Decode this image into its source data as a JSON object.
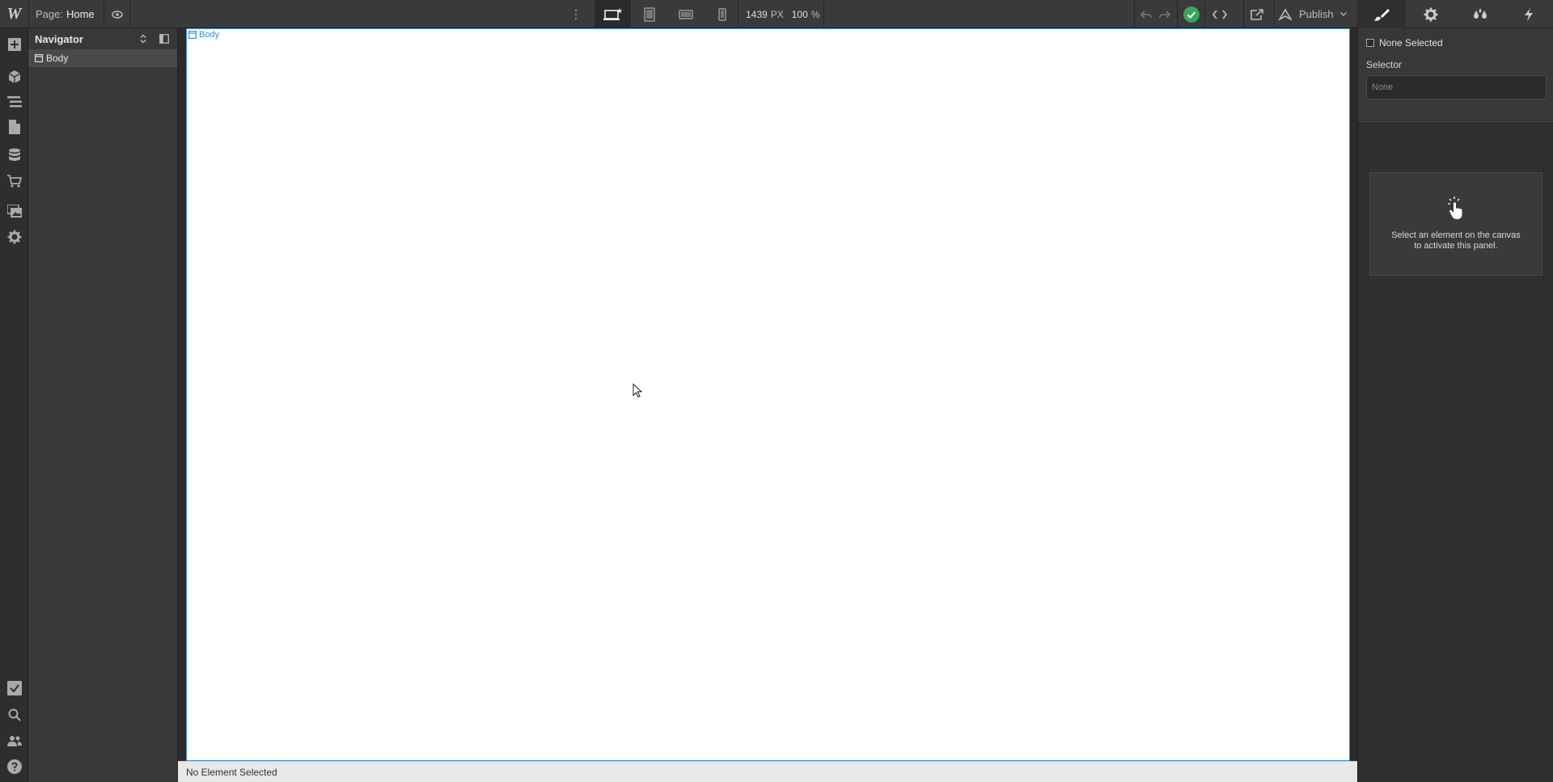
{
  "app": {
    "logo": "W"
  },
  "topbar": {
    "page_prefix": "Page:",
    "page_name": "Home",
    "viewport_width": "1439",
    "viewport_unit": "PX",
    "zoom": "100",
    "zoom_unit": "%",
    "publish_label": "Publish",
    "status_color": "#3aa55b"
  },
  "navigator": {
    "title": "Navigator",
    "items": [
      {
        "label": "Body"
      }
    ]
  },
  "canvas": {
    "body_tag": "Body",
    "accent": "#3b8fd9"
  },
  "statusbar": {
    "text": "No Element Selected"
  },
  "rightpanel": {
    "none_selected": "None Selected",
    "selector_label": "Selector",
    "selector_placeholder": "None",
    "hint_line1": "Select an element on the canvas",
    "hint_line2": "to activate this panel."
  },
  "icons": {
    "rail": [
      "add-icon",
      "cube-icon",
      "navigator-icon",
      "pages-icon",
      "cms-icon",
      "ecommerce-icon",
      "assets-icon",
      "settings-icon",
      "tasks-icon",
      "search-icon",
      "users-icon",
      "help-icon"
    ],
    "topbar_right": [
      "undo-icon",
      "redo-icon",
      "check-circle-icon",
      "code-icon",
      "export-icon",
      "publish-icon"
    ],
    "panel_tabs": [
      "brush-icon",
      "gear-icon",
      "drops-icon",
      "bolt-icon"
    ]
  }
}
